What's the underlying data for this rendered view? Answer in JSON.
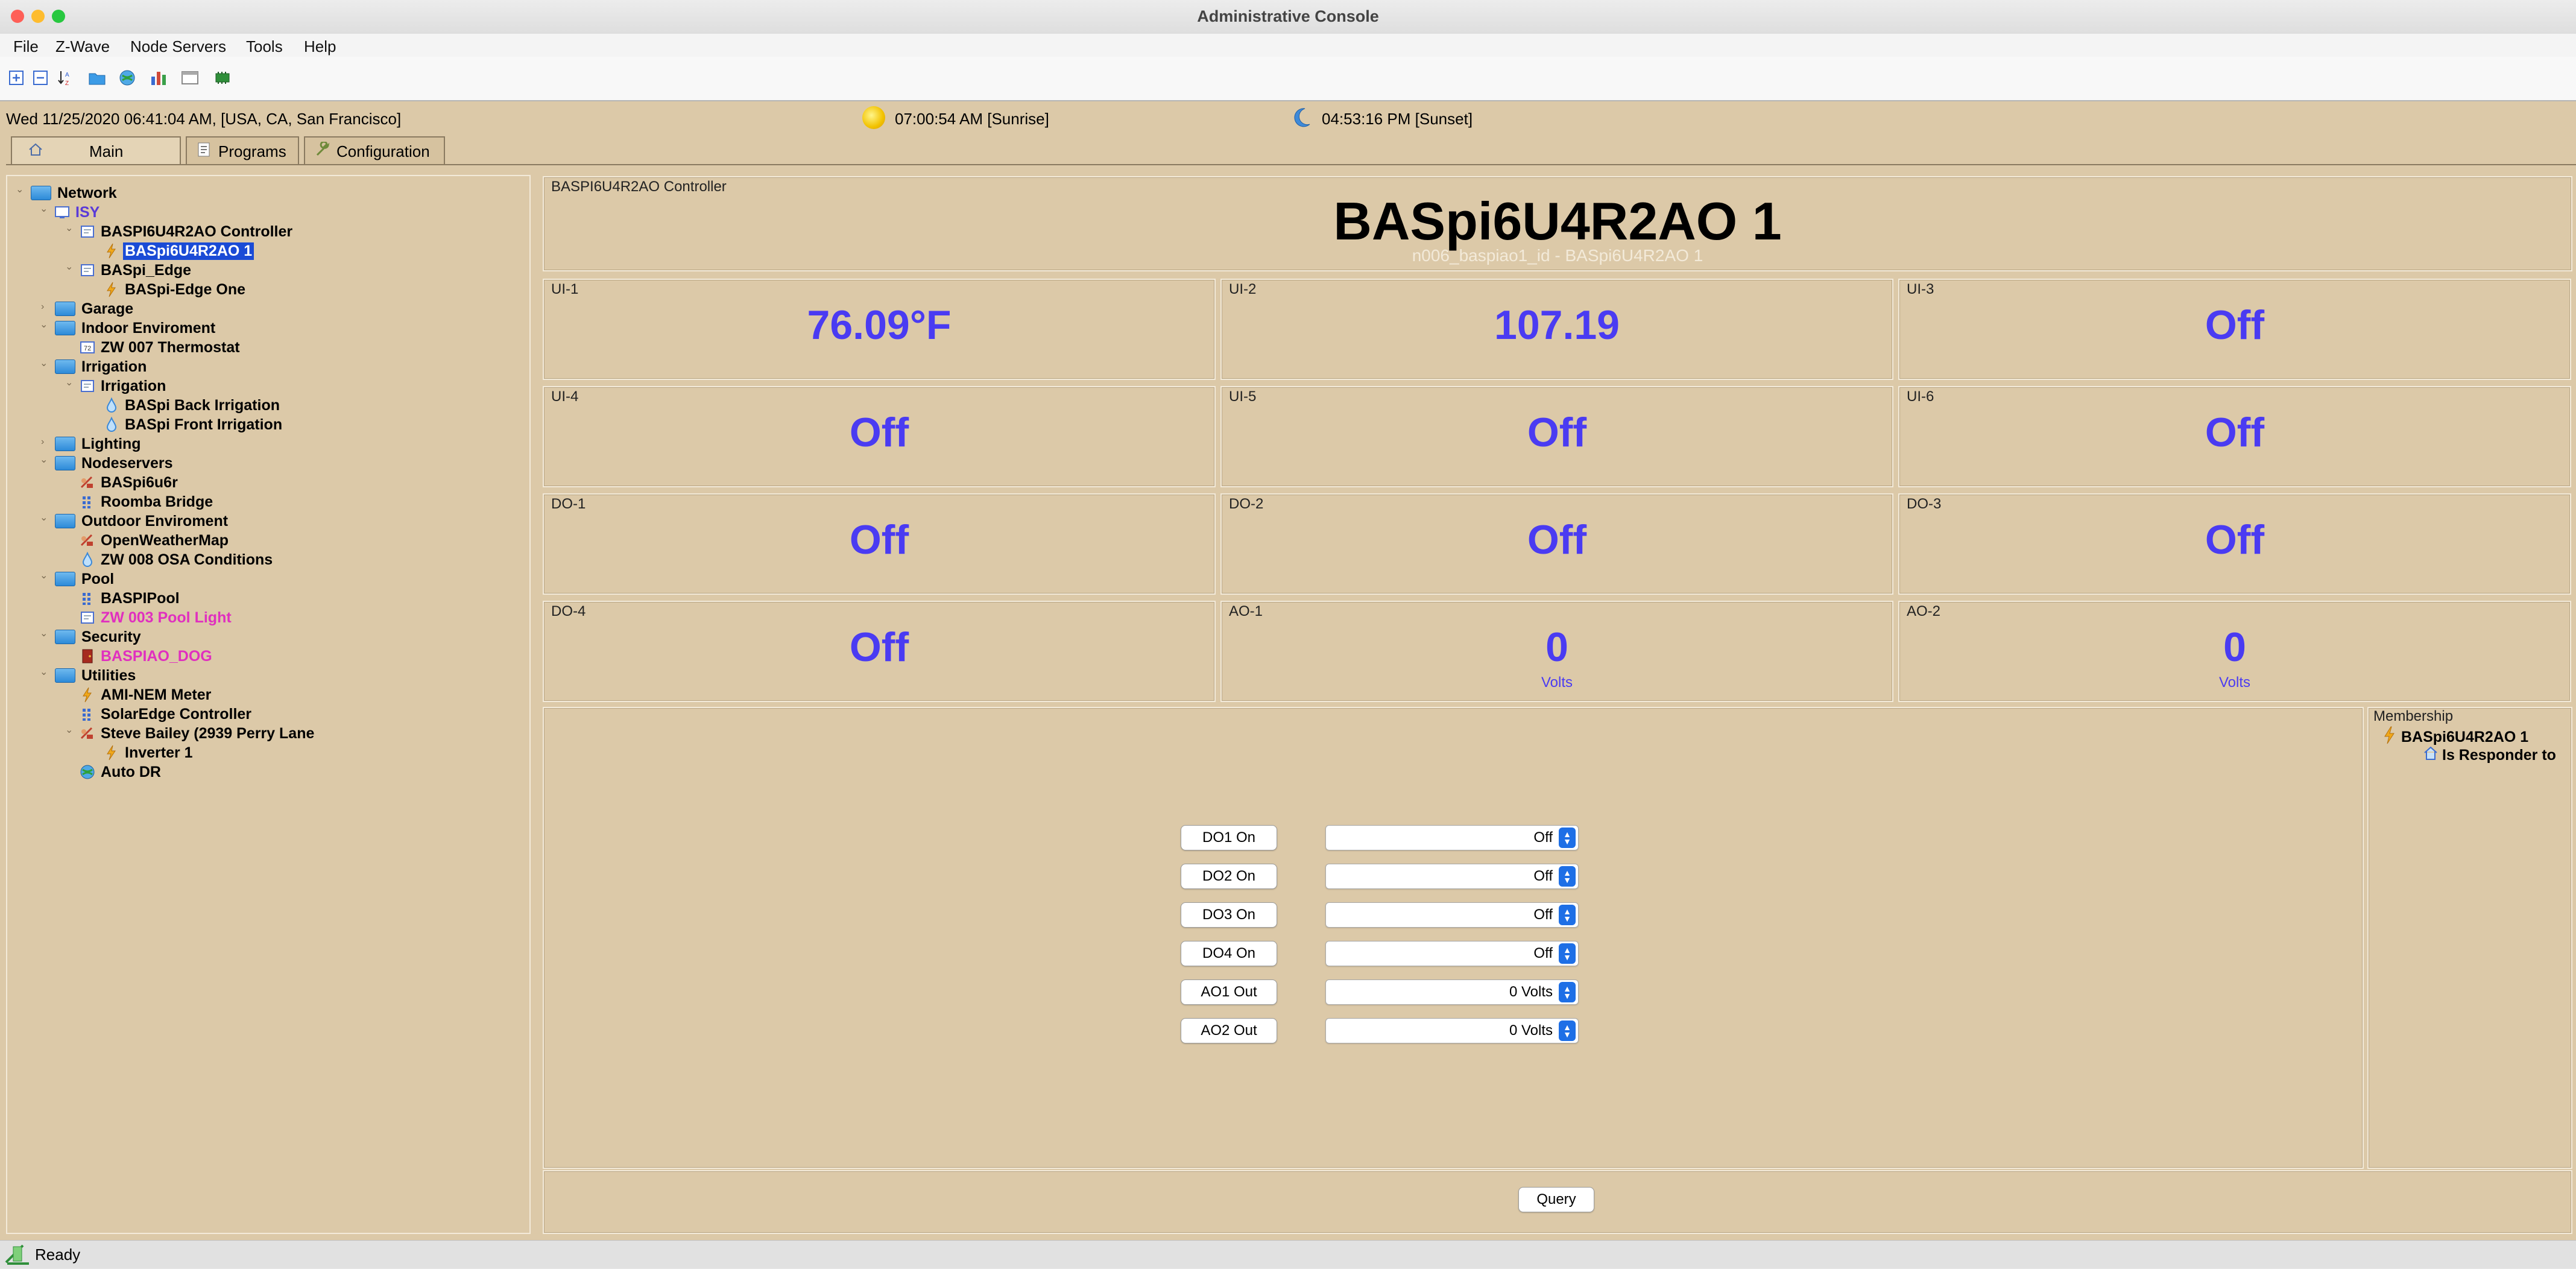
{
  "window": {
    "title": "Administrative Console"
  },
  "menu": [
    "File",
    "Z-Wave",
    "Node Servers",
    "Tools",
    "Help"
  ],
  "toolbar_icons": [
    "expand-all-icon",
    "collapse-all-icon",
    "sort-icon",
    "folder-icon",
    "globe-icon",
    "chart-icon",
    "window-icon",
    "device-icon"
  ],
  "info": {
    "datetime": "Wed 11/25/2020 06:41:04 AM,  [USA, CA, San Francisco]",
    "sunrise": "07:00:54 AM [Sunrise]",
    "sunset": "04:53:16 PM [Sunset]"
  },
  "tabs": [
    "Main",
    "Programs",
    "Configuration"
  ],
  "tree": [
    {
      "label": "Network",
      "type": "folder",
      "level": 0
    },
    {
      "label": "ISY",
      "type": "isy",
      "level": 1
    },
    {
      "label": "BASPI6U4R2AO Controller",
      "type": "device",
      "level": 2
    },
    {
      "label": "BASpi6U4R2AO 1",
      "type": "bolt",
      "level": 3,
      "selected": true
    },
    {
      "label": "BASpi_Edge",
      "type": "device",
      "level": 2
    },
    {
      "label": "BASpi-Edge One",
      "type": "bolt",
      "level": 3
    },
    {
      "label": "Garage",
      "type": "folder",
      "level": 1
    },
    {
      "label": "Indoor Enviroment",
      "type": "folder",
      "level": 1
    },
    {
      "label": "ZW 007 Thermostat",
      "type": "thermo",
      "level": 2
    },
    {
      "label": "Irrigation",
      "type": "folder",
      "level": 1
    },
    {
      "label": "Irrigation",
      "type": "device",
      "level": 2
    },
    {
      "label": "BASpi Back Irrigation",
      "type": "drop",
      "level": 3
    },
    {
      "label": "BASpi Front Irrigation",
      "type": "drop",
      "level": 3
    },
    {
      "label": "Lighting",
      "type": "folder",
      "level": 1
    },
    {
      "label": "Nodeservers",
      "type": "folder",
      "level": 1
    },
    {
      "label": "BASpi6u6r",
      "type": "ns",
      "level": 2
    },
    {
      "label": "Roomba Bridge",
      "type": "grid",
      "level": 2
    },
    {
      "label": "Outdoor Enviroment",
      "type": "folder",
      "level": 1
    },
    {
      "label": "OpenWeatherMap",
      "type": "ns",
      "level": 2
    },
    {
      "label": "ZW 008 OSA Conditions",
      "type": "drop",
      "level": 2
    },
    {
      "label": "Pool",
      "type": "folder",
      "level": 1
    },
    {
      "label": "BASPIPool",
      "type": "grid",
      "level": 2
    },
    {
      "label": "ZW 003 Pool Light",
      "type": "device",
      "level": 2,
      "color": "#e02fbf"
    },
    {
      "label": "Security",
      "type": "folder",
      "level": 1
    },
    {
      "label": "BASPIAO_DOG",
      "type": "door",
      "level": 2,
      "color": "#e02fbf"
    },
    {
      "label": "Utilities",
      "type": "folder",
      "level": 1
    },
    {
      "label": "AMI-NEM Meter",
      "type": "bolt",
      "level": 2
    },
    {
      "label": "SolarEdge Controller",
      "type": "grid",
      "level": 2
    },
    {
      "label": "Steve Bailey (2939 Perry Lane",
      "type": "ns",
      "level": 2
    },
    {
      "label": "Inverter 1",
      "type": "bolt",
      "level": 3
    },
    {
      "label": "Auto DR",
      "type": "globe",
      "level": 2
    }
  ],
  "header": {
    "group_title": "BASPI6U4R2AO Controller",
    "name": "BASpi6U4R2AO 1",
    "sub": "n006_baspiao1_id - BASpi6U4R2AO 1"
  },
  "tiles": [
    {
      "label": "UI-1",
      "value": "76.09°F",
      "unit": ""
    },
    {
      "label": "UI-2",
      "value": "107.19",
      "unit": ""
    },
    {
      "label": "UI-3",
      "value": "Off",
      "unit": ""
    },
    {
      "label": "UI-4",
      "value": "Off",
      "unit": ""
    },
    {
      "label": "UI-5",
      "value": "Off",
      "unit": ""
    },
    {
      "label": "UI-6",
      "value": "Off",
      "unit": ""
    },
    {
      "label": "DO-1",
      "value": "Off",
      "unit": ""
    },
    {
      "label": "DO-2",
      "value": "Off",
      "unit": ""
    },
    {
      "label": "DO-3",
      "value": "Off",
      "unit": ""
    },
    {
      "label": "DO-4",
      "value": "Off",
      "unit": ""
    },
    {
      "label": "AO-1",
      "value": "0",
      "unit": "Volts"
    },
    {
      "label": "AO-2",
      "value": "0",
      "unit": "Volts"
    }
  ],
  "controls": [
    {
      "button": "DO1 On",
      "value": "Off"
    },
    {
      "button": "DO2 On",
      "value": "Off"
    },
    {
      "button": "DO3 On",
      "value": "Off"
    },
    {
      "button": "DO4 On",
      "value": "Off"
    },
    {
      "button": "AO1 Out",
      "value": "0 Volts"
    },
    {
      "button": "AO2 Out",
      "value": "0 Volts"
    }
  ],
  "membership": {
    "title": "Membership",
    "node": "BASpi6U4R2AO 1",
    "role": "Is Responder to"
  },
  "query_label": "Query",
  "status": "Ready",
  "colors": {
    "value": "#4a3bf2",
    "panel_bg": "#dcc9a8",
    "selection": "#1a4bd6",
    "warn_text": "#e02fbf"
  }
}
